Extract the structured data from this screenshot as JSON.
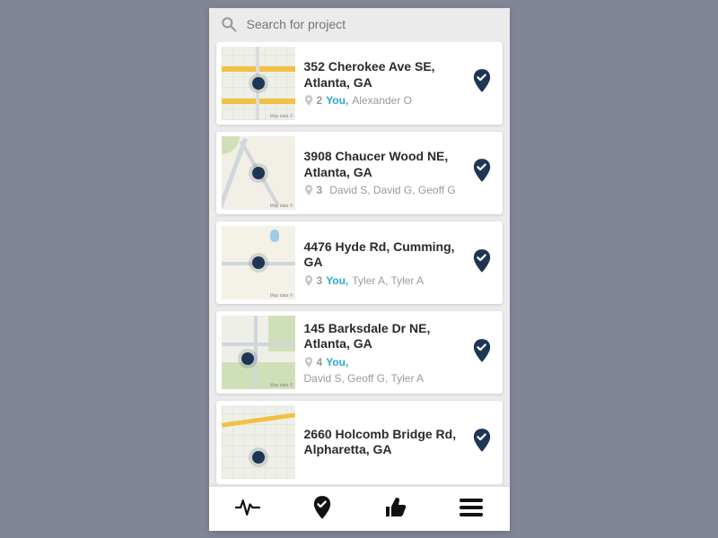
{
  "search": {
    "placeholder": "Search for project"
  },
  "projects": [
    {
      "address": "352 Cherokee Ave SE, Atlanta, GA",
      "count": "2",
      "you": "You,",
      "people": "Alexander O"
    },
    {
      "address": "3908 Chaucer Wood NE, Atlanta, GA",
      "count": "3",
      "you": "",
      "people": "David S, David G, Geoff G"
    },
    {
      "address": "4476 Hyde Rd, Cumming, GA",
      "count": "3",
      "you": "You,",
      "people": "Tyler A, Tyler A"
    },
    {
      "address": "145 Barksdale Dr NE, Atlanta, GA",
      "count": "4",
      "you": "You,",
      "people": "David S, Geoff G, Tyler A"
    },
    {
      "address": "2660 Holcomb Bridge Rd, Alpharetta, GA",
      "count": "",
      "you": "",
      "people": ""
    }
  ],
  "colors": {
    "accent": "#1e3553",
    "you": "#2aa8cf",
    "muted": "#9a9a9a"
  }
}
